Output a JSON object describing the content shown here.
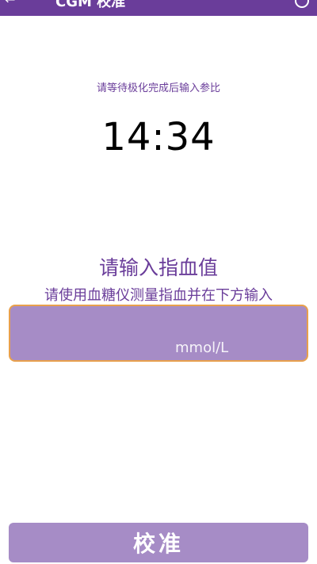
{
  "header": {
    "title": "CGM 校准"
  },
  "status": {
    "wait_message": "请等待极化完成后输入参比",
    "timer": "14:34"
  },
  "input": {
    "heading": "请输入指血值",
    "subheading": "请使用血糖仪测量指血并在下方输入",
    "unit": "mmol/L",
    "value": ""
  },
  "actions": {
    "calibrate_label": "校准"
  },
  "colors": {
    "primary": "#6a3d9a",
    "field_bg": "#a68cc6",
    "field_border": "#e8a04c"
  }
}
